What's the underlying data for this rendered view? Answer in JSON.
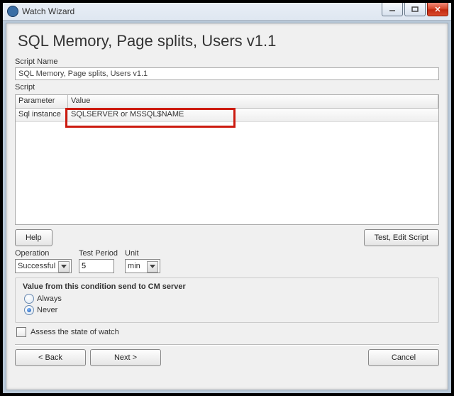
{
  "window": {
    "title": "Watch Wizard"
  },
  "page": {
    "title": "SQL Memory, Page splits, Users v1.1"
  },
  "script_name": {
    "label": "Script Name",
    "value": "SQL Memory, Page splits, Users v1.1"
  },
  "script": {
    "label": "Script",
    "columns": {
      "parameter": "Parameter",
      "value": "Value"
    },
    "rows": [
      {
        "param": "Sql instance",
        "value": "SQLSERVER or MSSQL$NAME"
      }
    ]
  },
  "buttons": {
    "help": "Help",
    "test_edit": "Test, Edit Script",
    "back": "<  Back",
    "next": "Next  >",
    "cancel": "Cancel"
  },
  "operation": {
    "label": "Operation",
    "selected": "Successful"
  },
  "test_period": {
    "label": "Test Period",
    "value": "5"
  },
  "unit": {
    "label": "Unit",
    "selected": "min"
  },
  "cm_group": {
    "title": "Value from this condition send to CM server",
    "always": "Always",
    "never": "Never",
    "selected": "never"
  },
  "assess": {
    "label": "Assess the state of watch",
    "checked": false
  }
}
